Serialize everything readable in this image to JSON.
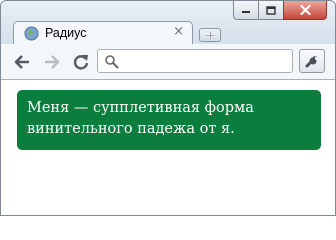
{
  "window": {
    "tab_title": "Радиус",
    "tab_close": "×"
  },
  "toolbar": {
    "address_value": "",
    "address_placeholder": ""
  },
  "content": {
    "message": "Меня — супплетивная форма винительного падежа от я."
  },
  "colors": {
    "message_bg": "#0b7d3c",
    "message_text": "#ffffff",
    "chrome_frame": "#d9e3ee"
  },
  "icons": {
    "favicon": "globe-icon",
    "back": "back-arrow-icon",
    "forward": "forward-arrow-icon",
    "reload": "reload-icon",
    "search": "search-icon",
    "wrench": "wrench-icon",
    "new_tab": "new-tab-icon",
    "minimize": "minimize-icon",
    "maximize": "maximize-icon",
    "close": "close-icon"
  }
}
